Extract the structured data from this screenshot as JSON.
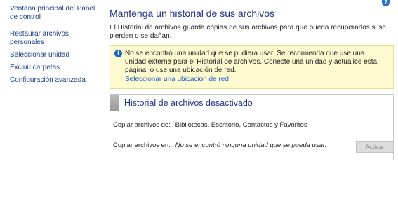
{
  "help": {
    "icon": "help-icon",
    "symbol": "?"
  },
  "sidebar": {
    "home_link": "Ventana principal del Panel de control",
    "items": [
      {
        "label": "Restaurar archivos personales"
      },
      {
        "label": "Seleccionar unidad"
      },
      {
        "label": "Excluir carpetas"
      },
      {
        "label": "Configuración avanzada"
      }
    ]
  },
  "main": {
    "title": "Mantenga un historial de sus archivos",
    "intro": "El Historial de archivos guarda copias de sus archivos para que pueda recuperarlos si se pierden o se dañan.",
    "alert": {
      "icon": "info-icon",
      "symbol": "i",
      "message": "No se encontró una unidad que se pudiera usar. Se recomienda que use una unidad externa para el Historial de archivos. Conecte una unidad y actualice esta página, o use una ubicación de red.",
      "link": "Seleccionar una ubicación de red"
    },
    "status": {
      "title": "Historial de archivos desactivado",
      "copy_label": "Copiar archivos de:",
      "copy_value": "Bibliotecas, Escritorio, Contactos y Favoritos",
      "dest_label": "Copiar archivos en:",
      "dest_value": "No se encontró ninguna unidad que se pueda usar."
    },
    "activate_button": "Activar"
  }
}
